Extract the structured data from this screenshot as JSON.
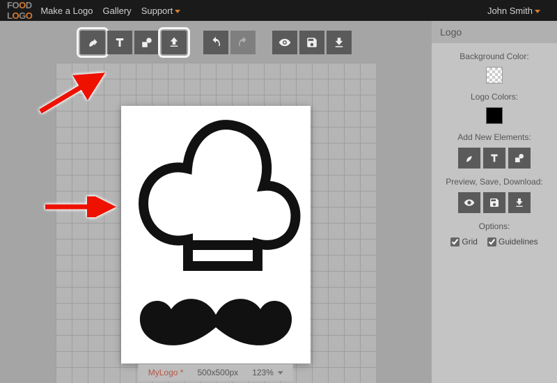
{
  "brand": {
    "line1": "FOOD",
    "line2": "LOGO"
  },
  "nav": {
    "make": "Make a Logo",
    "gallery": "Gallery",
    "support": "Support"
  },
  "user": {
    "name": "John Smith"
  },
  "toolbar": {
    "leaf": "leaf",
    "text": "text",
    "shape": "shape",
    "upload": "upload",
    "undo": "undo",
    "redo": "redo",
    "preview": "preview",
    "save": "save",
    "download": "download"
  },
  "status": {
    "name": "MyLogo *",
    "size": "500x500px",
    "zoom": "123%"
  },
  "panel": {
    "title": "Logo",
    "bgcolor_label": "Background Color:",
    "colors_label": "Logo Colors:",
    "addnew_label": "Add New Elements:",
    "psd_label": "Preview, Save, Download:",
    "options_label": "Options:",
    "grid_label": "Grid",
    "guidelines_label": "Guidelines"
  }
}
